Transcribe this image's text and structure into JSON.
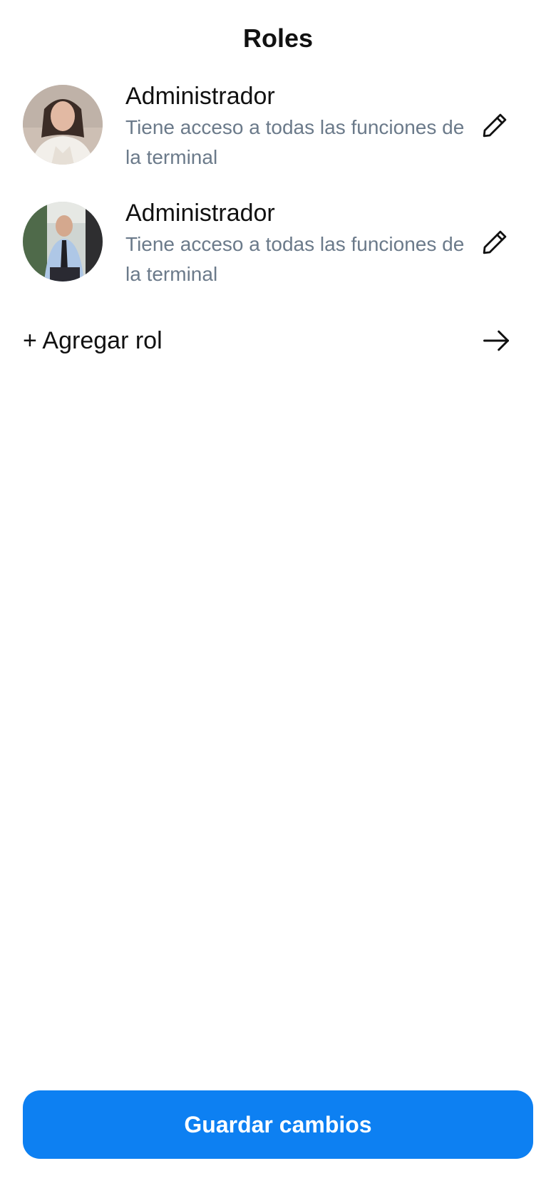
{
  "header": {
    "title": "Roles"
  },
  "roles": [
    {
      "name": "Administrador",
      "description": "Tiene acceso a todas las funciones de la terminal",
      "avatar_icon": "avatar-photo-woman",
      "edit_icon": "pencil-icon"
    },
    {
      "name": "Administrador",
      "description": "Tiene acceso a todas las funciones de la terminal",
      "avatar_icon": "avatar-photo-man",
      "edit_icon": "pencil-icon"
    }
  ],
  "add_role": {
    "label": "+ Agregar rol",
    "icon": "arrow-right-icon"
  },
  "footer": {
    "save_label": "Guardar cambios"
  },
  "colors": {
    "primary": "#0d80f2",
    "text": "#111111",
    "muted_text": "#6b7a8a",
    "background": "#ffffff"
  }
}
